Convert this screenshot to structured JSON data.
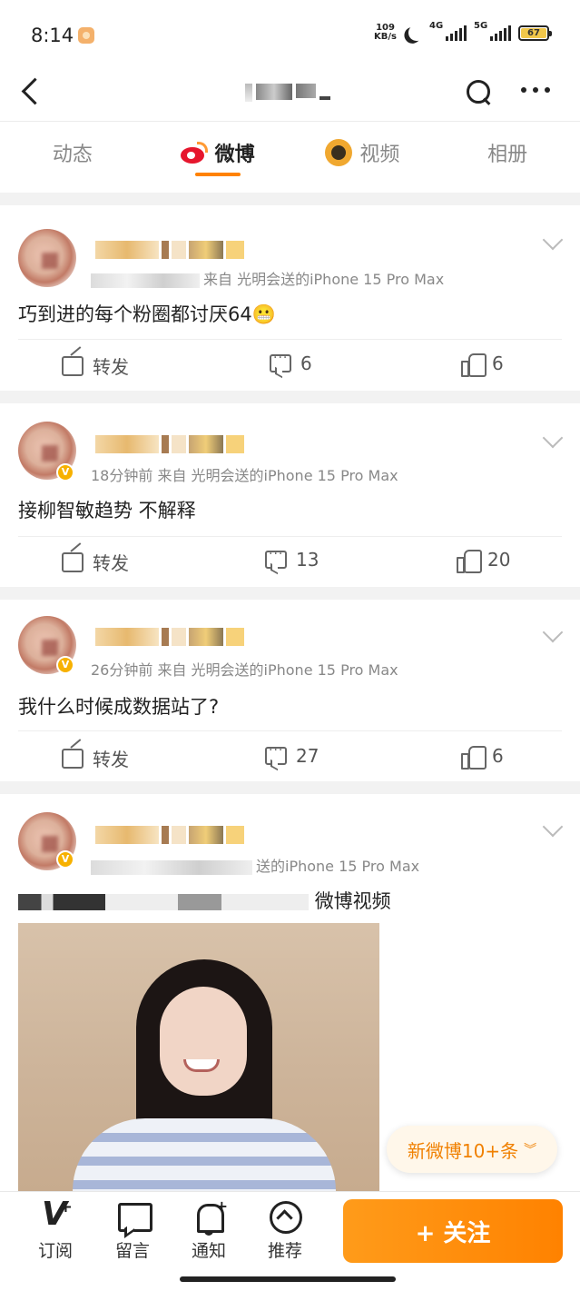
{
  "status_bar": {
    "time": "8:14",
    "net_speed_value": "109",
    "net_speed_unit": "KB/s",
    "sig1_label": "4G",
    "sig2_label": "5G",
    "battery": "67"
  },
  "tabs": [
    {
      "label": "动态"
    },
    {
      "label": "微博"
    },
    {
      "label": "视频"
    },
    {
      "label": "相册"
    }
  ],
  "colors": {
    "accent": "#ff8200",
    "weibo_red": "#e6162d"
  },
  "posts": [
    {
      "meta": "来自 光明会送的iPhone 15 Pro Max",
      "text": "巧到进的每个粉圈都讨厌64😬",
      "share_label": "转发",
      "comments": "6",
      "likes": "6"
    },
    {
      "meta": "18分钟前  来自 光明会送的iPhone 15 Pro Max",
      "text": "接柳智敏趋势 不解释",
      "share_label": "转发",
      "comments": "13",
      "likes": "20"
    },
    {
      "meta": "26分钟前  来自  光明会送的iPhone 15 Pro Max",
      "text": "我什么时候成数据站了?",
      "share_label": "转发",
      "comments": "27",
      "likes": "6"
    },
    {
      "meta": "送的iPhone 15 Pro Max",
      "text": "微博视频"
    }
  ],
  "new_posts_pill": "新微博10+条",
  "bottom_bar": {
    "subscribe": "订阅",
    "message": "留言",
    "notify": "通知",
    "recommend": "推荐",
    "follow": "+ 关注"
  },
  "icons": [
    "back-icon",
    "search-icon",
    "more-icon",
    "weibo-logo-icon",
    "video-icon",
    "share-icon",
    "comment-icon",
    "like-icon",
    "chevron-down-icon",
    "subscribe-icon",
    "message-icon",
    "bell-icon",
    "recommend-icon"
  ]
}
